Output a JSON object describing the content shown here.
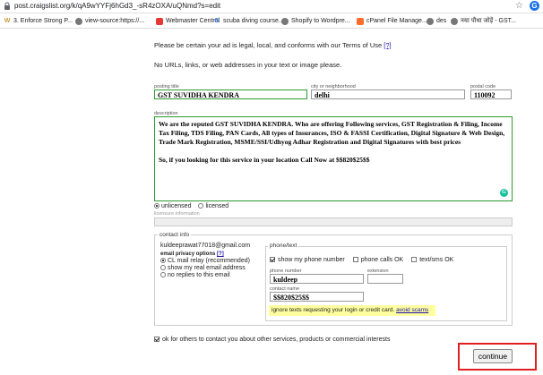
{
  "browser": {
    "url": "post.craigslist.org/k/qA9wYYFj6hGd3_-sR4zOXA/uQNmd?s=edit",
    "bookmarks": [
      {
        "label": "3. Enforce Strong P...",
        "icon": "w-icon",
        "color": "#c89b3c"
      },
      {
        "label": "view-source:https://...",
        "icon": "globe-icon",
        "color": "#555555"
      },
      {
        "label": "Webmaster Central",
        "icon": "webmaster-icon",
        "color": "#e53935"
      },
      {
        "label": "scuba diving course...",
        "icon": "google-icon",
        "color": "#4285f4"
      },
      {
        "label": "Shopify to Wordpre...",
        "icon": "globe-icon",
        "color": "#555555"
      },
      {
        "label": "cPanel File Manage...",
        "icon": "cpanel-icon",
        "color": "#ff6c2c"
      },
      {
        "label": "des",
        "icon": "globe-icon",
        "color": "#555555"
      },
      {
        "label": "नया पौधा जोड़ें - GST...",
        "icon": "globe-icon",
        "color": "#555555"
      }
    ]
  },
  "page": {
    "legal_notice": "Please be certain your ad is legal, local, and conforms with our Terms of Use",
    "terms_link": "[?]",
    "no_urls_notice": "No URLs, links, or web addresses in your text or image please.",
    "posting_title_label": "posting title",
    "posting_title": "GST SUVIDHA KENDRA",
    "city_label": "city or neighborhood",
    "city": "delhi",
    "postal_label": "postal code",
    "postal_code": "110092",
    "description_label": "description",
    "description_p1": "We are the reputed GST SUVIDHA KENDRA. Who are offering Following services, GST Registration & Filing, Income Tax Filing, TDS Filing, PAN Cards, All types of Insurances, ISO & FASSI Certification, Digital Signature & Web Design, Trade Mark Registration, MSME/SSI/Udhyog Adhar Registration and Digital Signatures with best prices",
    "description_p2": "So, if you looking for this service in your location Call Now at $$820$25$$",
    "license_unlicensed": "unlicensed",
    "license_licensed": "licensed",
    "license_info_label": "licensure information",
    "contact_info_legend": "contact info",
    "email": "kuldeeprawat77018@gmail.com",
    "email_privacy_label": "email privacy options",
    "email_privacy_help": "[?]",
    "privacy_options": [
      "CL mail relay (recommended)",
      "show my real email address",
      "no replies to this email"
    ],
    "phone_legend": "phone/text",
    "show_phone": "show my phone number",
    "phone_calls_ok": "phone calls OK",
    "text_sms_ok": "text/sms OK",
    "phone_number_label": "phone number",
    "phone_number": "kuldeep",
    "extension_label": "extension",
    "extension": "",
    "contact_name_label": "contact name",
    "contact_name": "$$820$25$$",
    "warning_text": "ignore texts requesting your login or credit card.",
    "avoid_scams_link": "avoid scams",
    "ok_contact": "ok for others to contact you about other services, products or commercial interests",
    "continue_button": "continue"
  }
}
